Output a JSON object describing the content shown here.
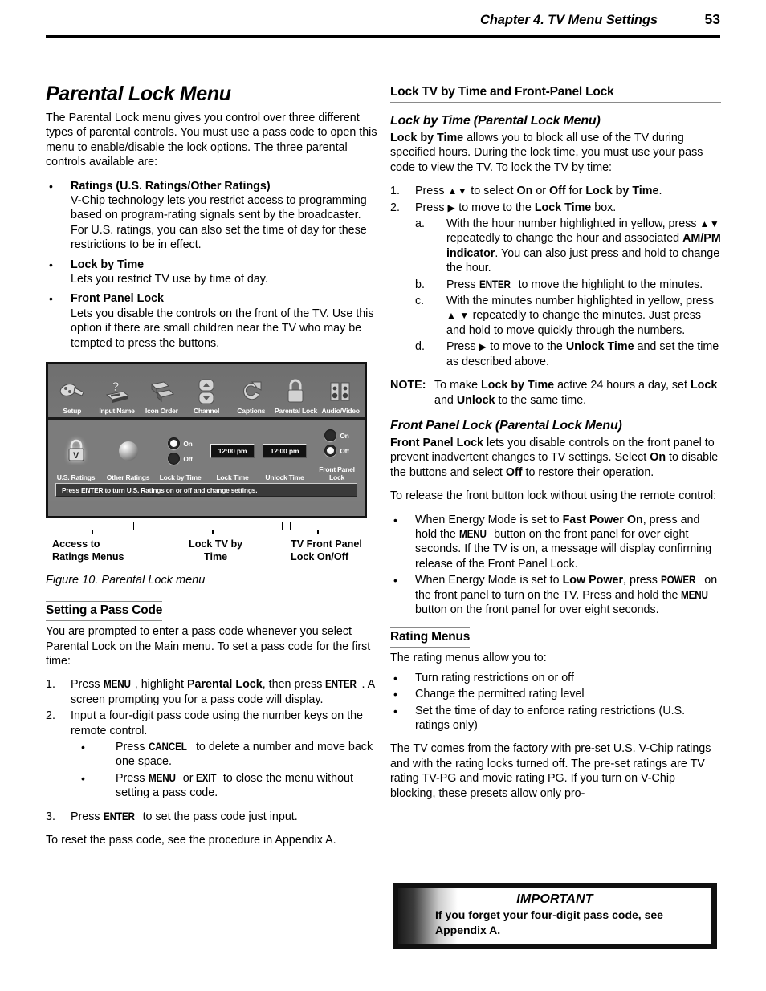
{
  "header": {
    "chapter_title": "Chapter 4. TV Menu Settings",
    "page_number": "53"
  },
  "left_column": {
    "title": "Parental Lock Menu",
    "intro": "The Parental Lock menu gives you control over three different types of parental controls.  You must use a pass code to open this menu to enable/disable the lock options.  The three parental controls available are:",
    "bullets": [
      {
        "lead": "Ratings (U.S. Ratings/Other Ratings)",
        "body": "V-Chip technology lets you restrict access to programming based on program-rating signals sent by the broadcaster.  For U.S. ratings, you can also set the time of day for these restrictions to be in effect."
      },
      {
        "lead": "Lock by Time",
        "body": "Lets you restrict TV use by time of day."
      },
      {
        "lead": "Front Panel Lock",
        "body": "Lets you disable the controls on the front of the TV.  Use this option if there are small children near the TV who may be tempted to press the buttons."
      }
    ],
    "figure": {
      "icon_row": [
        {
          "label": "Setup",
          "icon": "plug-icon"
        },
        {
          "label": "Input Name",
          "icon": "input-name-icon"
        },
        {
          "label": "Icon Order",
          "icon": "icon-order-icon"
        },
        {
          "label": "Channel",
          "icon": "channel-updown-icon"
        },
        {
          "label": "Captions",
          "icon": "captions-icon"
        },
        {
          "label": "Parental Lock",
          "icon": "padlock-icon"
        },
        {
          "label": "Audio/Video",
          "icon": "speakers-icon"
        }
      ],
      "controls": [
        {
          "label": "U.S. Ratings",
          "type": "lock-v-icon"
        },
        {
          "label": "Other Ratings",
          "type": "sphere-button"
        },
        {
          "label": "Lock by Time",
          "type": "radio-pair",
          "on_label": "On",
          "off_label": "Off",
          "selected": "On"
        },
        {
          "label": "Lock Time",
          "type": "time-box",
          "value": "12:00 pm"
        },
        {
          "label": "Unlock Time",
          "type": "time-box",
          "value": "12:00 pm"
        },
        {
          "label": "Front Panel Lock",
          "type": "radio-pair",
          "on_label": "On",
          "off_label": "Off",
          "selected": "Off"
        }
      ],
      "message_bar": "Press ENTER to turn U.S. Ratings on or off and change settings.",
      "callouts": [
        {
          "label": "Access to\nRatings Menus"
        },
        {
          "label": "Lock TV by\nTime"
        },
        {
          "label": "TV Front Panel\nLock On/Off"
        }
      ],
      "caption": "Figure 10.  Parental Lock menu"
    },
    "pass_code": {
      "heading": "Setting a Pass Code",
      "intro": "You are prompted to enter a pass code whenever you select Parental Lock on the Main menu.  To set a pass code for the first time:",
      "step1_parts": {
        "a": "Press ",
        "key1": "MENU",
        "b": ", highlight ",
        "bold": "Parental Lock",
        "c": ", then press ",
        "key2": "ENTER",
        "d": ".  A screen prompting you for a pass code will display."
      },
      "step2": "Input a four-digit pass code using the number keys on the remote control.",
      "sub_bullets": [
        {
          "a": "Press ",
          "key": "CANCEL",
          "b": " to delete a number and move back one space."
        },
        {
          "a": "Press ",
          "key": "MENU",
          "b": " or ",
          "key2": "EXIT",
          "c": " to close the menu without setting a pass code."
        }
      ],
      "step3": {
        "a": "Press ",
        "key": "ENTER",
        "b": " to set the pass code just input."
      },
      "closing": "To reset the pass code, see the procedure in Appendix A.",
      "numbers": {
        "n1": "1.",
        "n2": "2.",
        "n3": "3."
      }
    }
  },
  "right_column": {
    "section_heading": "Lock TV by Time and Front-Panel Lock",
    "lock_by_time": {
      "heading": "Lock by Time (Parental Lock Menu)",
      "intro_bold": "Lock by Time",
      "intro_rest": " allows you to block all use of the TV during specified hours.  During the lock time, you must use your pass code to view the TV.  To lock the TV by time:",
      "step1": {
        "n": "1.",
        "a": "Press ",
        "arrows": "▲▼",
        "b": " to select ",
        "on": "On",
        "c": " or ",
        "off": "Off",
        "d": " for ",
        "e": "Lock by Time",
        "f": "."
      },
      "step2": {
        "n": "2.",
        "a": "Press ",
        "arrow": "▶",
        "b": " to move to the ",
        "c": "Lock Time",
        "d": " box."
      },
      "substeps": [
        {
          "mark": "a.",
          "a": "With the hour number highlighted in yellow, press ",
          "arrows": "▲▼",
          "b": " repeatedly to change the hour and associated ",
          "bold": "AM/PM indicator",
          "c": ".  You can also just press and hold to change the hour."
        },
        {
          "mark": "b.",
          "a": "Press ",
          "key": "ENTER",
          "b": " to move the highlight to the minutes."
        },
        {
          "mark": "c.",
          "a": "With the minutes number highlighted in yellow, press ",
          "arrows": "▲ ▼",
          "b": " repeatedly to change the minutes.  Just press and hold to move quickly through the numbers."
        },
        {
          "mark": "d.",
          "a": "Press ",
          "arrow": "▶",
          "b": " to move to the ",
          "bold": "Unlock Time",
          "c": " and set the time as described above."
        }
      ],
      "note": {
        "label": "NOTE:",
        "a": "To make ",
        "bold1": "Lock by Time",
        "b": " active 24 hours a day, set ",
        "bold2": "Lock",
        "c": " and ",
        "bold3": "Unlock",
        "d": " to the same time."
      }
    },
    "front_panel_lock": {
      "heading": "Front Panel Lock (Parental Lock Menu)",
      "intro_bold": "Front Panel Lock",
      "intro_rest": " lets you disable controls on the front panel to prevent inadvertent changes to TV settings.  Select ",
      "on": "On",
      "intro_mid": " to disable the buttons and select ",
      "off": "Off",
      "intro_end": " to restore their operation.",
      "release_intro": "To release the front button lock without using the remote control:",
      "bullets": [
        {
          "a": "When Energy Mode is set to ",
          "bold": "Fast Power On",
          "b": ", press and hold the ",
          "key": "MENU",
          "c": " button on the front panel for over eight seconds.  If the TV is on, a message will display confirming release of the Front Panel Lock."
        },
        {
          "a": "When Energy Mode is set to ",
          "bold": "Low Power",
          "b": ", press ",
          "key": "POWER",
          "c": " on the front panel to turn on the TV.  Press and hold the ",
          "key2": "MENU",
          "d": " button on the front panel for over eight seconds."
        }
      ]
    },
    "rating_menus": {
      "heading": "Rating Menus",
      "intro": "The rating menus allow you to:",
      "bullets": [
        "Turn rating restrictions on or off",
        "Change the permitted rating level",
        "Set the time of day to enforce rating restrictions (U.S. ratings only)"
      ],
      "closing": "The TV comes from the factory with pre-set U.S. V-Chip ratings and with the rating locks turned off.  The pre-set ratings are TV rating TV-PG and movie rating PG.  If you turn on V-Chip blocking, these presets allow only pro-"
    },
    "important_box": {
      "title": "IMPORTANT",
      "body": "If you forget your four-digit pass code, see Appendix A."
    }
  }
}
